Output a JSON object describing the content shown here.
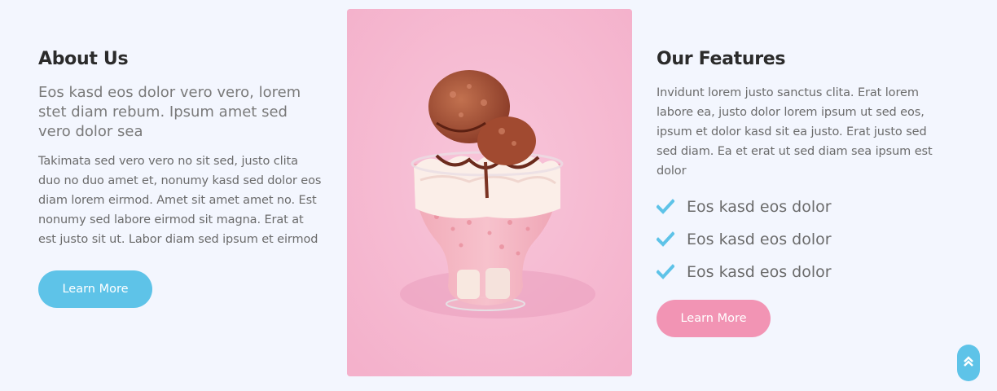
{
  "about": {
    "title": "About Us",
    "lead": "Eos kasd eos dolor vero vero, lorem stet diam rebum. Ipsum amet sed vero dolor sea",
    "body": "Takimata sed vero vero no sit sed, justo clita duo no duo amet et, nonumy kasd sed dolor eos diam lorem eirmod. Amet sit amet amet no. Est nonumy sed labore eirmod sit magna. Erat at est justo sit ut. Labor diam sed ipsum et eirmod",
    "button_label": "Learn More"
  },
  "features": {
    "title": "Our Features",
    "body": "Invidunt lorem justo sanctus clita. Erat lorem labore ea, justo dolor lorem ipsum ut sed eos, ipsum et dolor kasd sit ea justo. Erat justo sed sed diam. Ea et erat ut sed diam sea ipsum est dolor",
    "items": [
      {
        "label": "Eos kasd eos dolor",
        "icon": "check-icon"
      },
      {
        "label": "Eos kasd eos dolor",
        "icon": "check-icon"
      },
      {
        "label": "Eos kasd eos dolor",
        "icon": "check-icon"
      }
    ],
    "button_label": "Learn More"
  },
  "image": {
    "subject": "ice-cream-cup-photo"
  },
  "colors": {
    "background": "#f3f6fe",
    "accent_blue": "#5ec3e8",
    "accent_pink": "#f294b4",
    "heading": "#2b2b2b",
    "text": "#6b6b6b"
  },
  "scroll_top": {
    "icon": "double-chevron-up-icon"
  }
}
